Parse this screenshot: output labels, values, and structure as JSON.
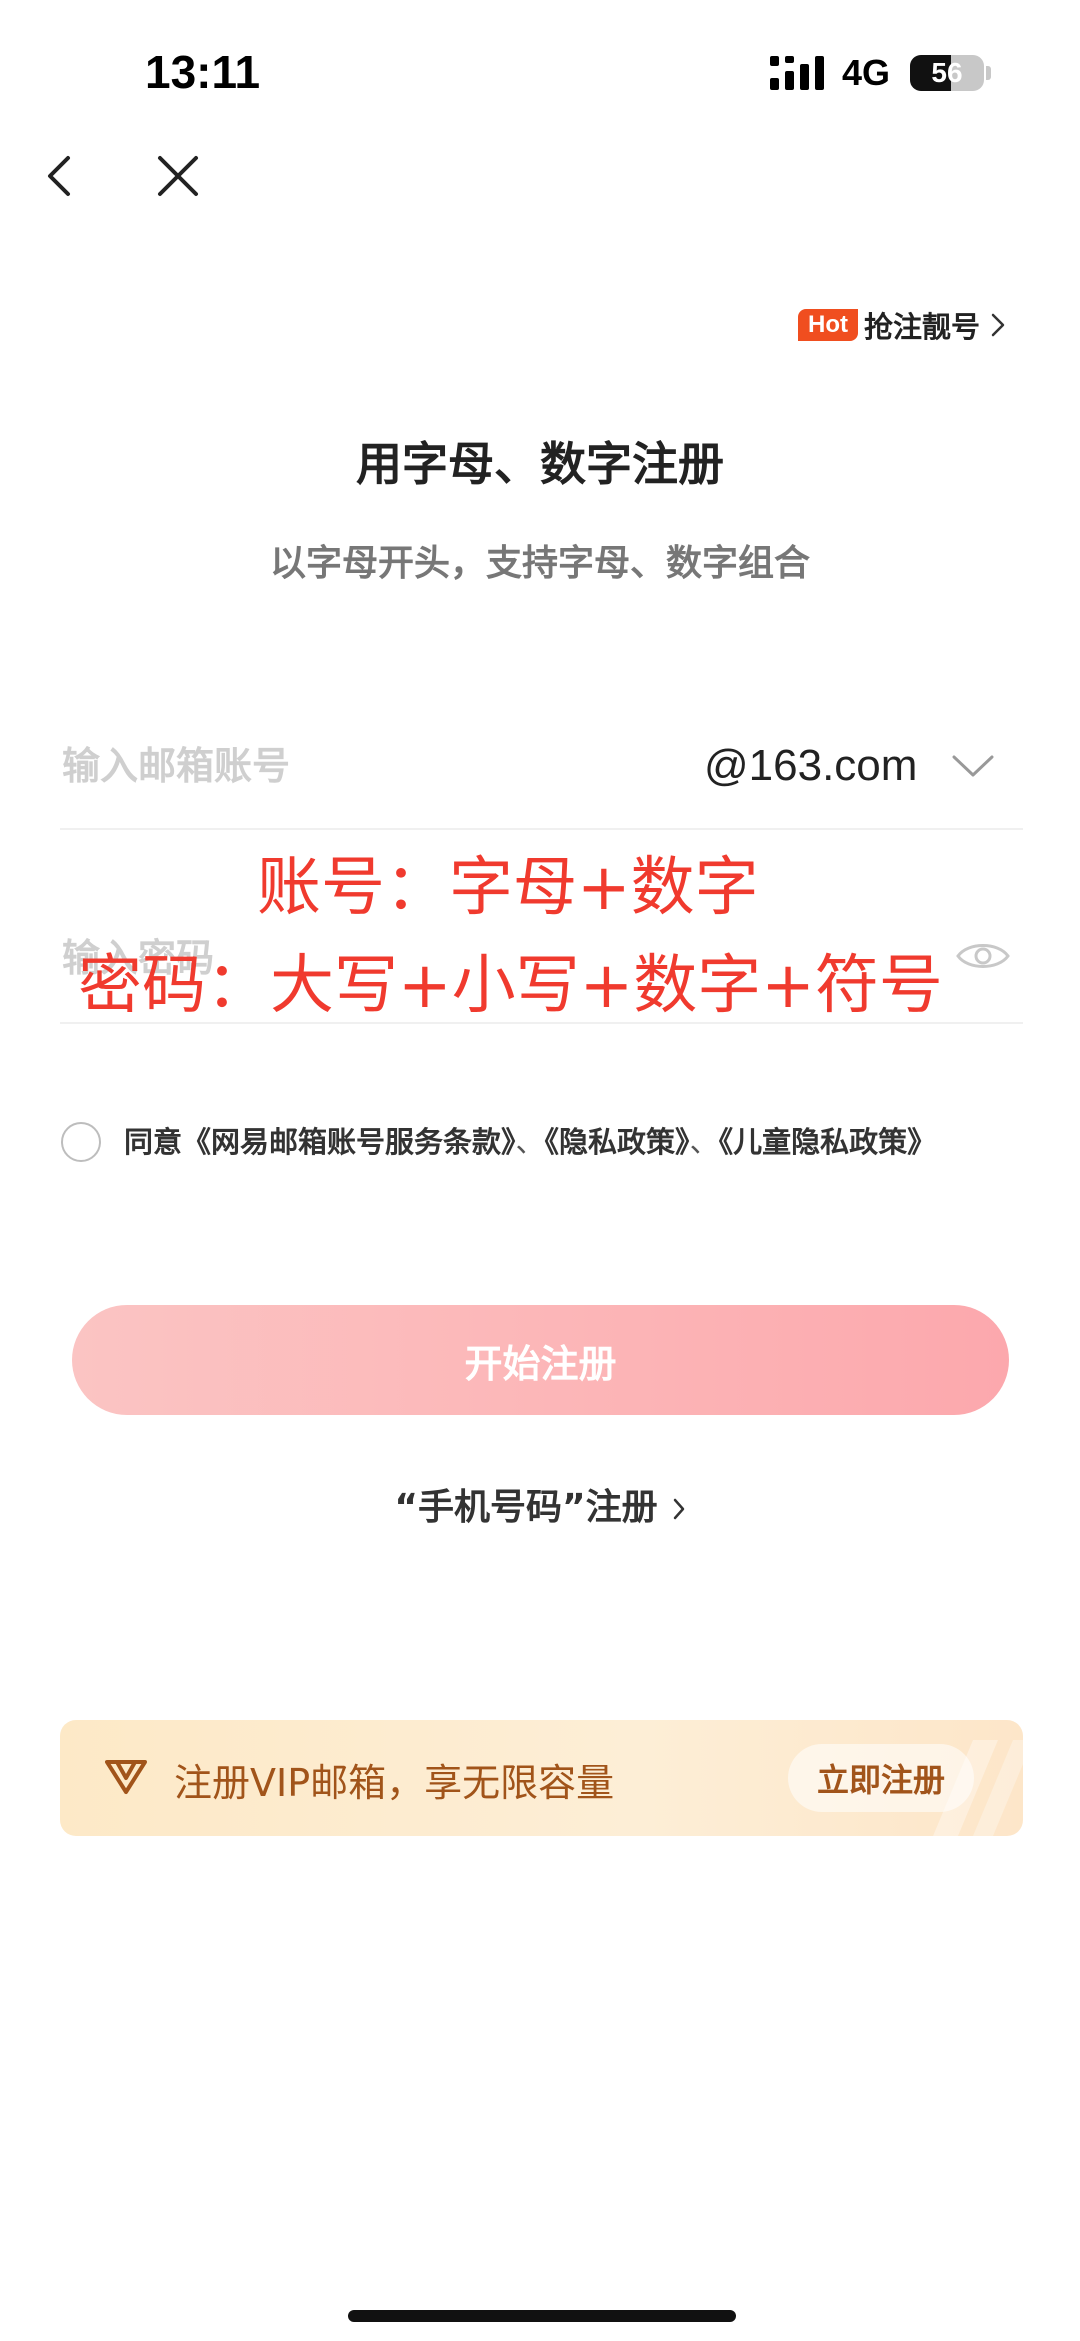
{
  "status_bar": {
    "time": "13:11",
    "network": "4G",
    "battery": "56",
    "battery_level": 0.56
  },
  "nav": {
    "back_icon": "chevron-left-icon",
    "close_icon": "close-icon"
  },
  "hot_link": {
    "badge": "Hot",
    "label": "抢注靓号"
  },
  "header": {
    "title": "用字母、数字注册",
    "subtitle": "以字母开头，支持字母、数字组合"
  },
  "form": {
    "account_placeholder": "输入邮箱账号",
    "domain": "@163.com",
    "password_placeholder": "输入密码"
  },
  "overlay": {
    "line1": "账号：字母+数字",
    "line2": "密码：大写+小写+数字+符号"
  },
  "agreement": {
    "prefix": "同意",
    "terms": "《网易邮箱账号服务条款》",
    "sep1": "、",
    "privacy": "《隐私政策》",
    "sep2": "、",
    "child_privacy": "《儿童隐私政策》"
  },
  "actions": {
    "start_label": "开始注册",
    "phone_label": "“手机号码”注册"
  },
  "vip": {
    "text": "注册VIP邮箱，享无限容量",
    "button": "立即注册"
  },
  "colors": {
    "accent_red": "#f03a2e",
    "button_pink": "#fcb4b6",
    "vip_brown": "#a1541a",
    "hot_orange": "#f04e1f"
  }
}
